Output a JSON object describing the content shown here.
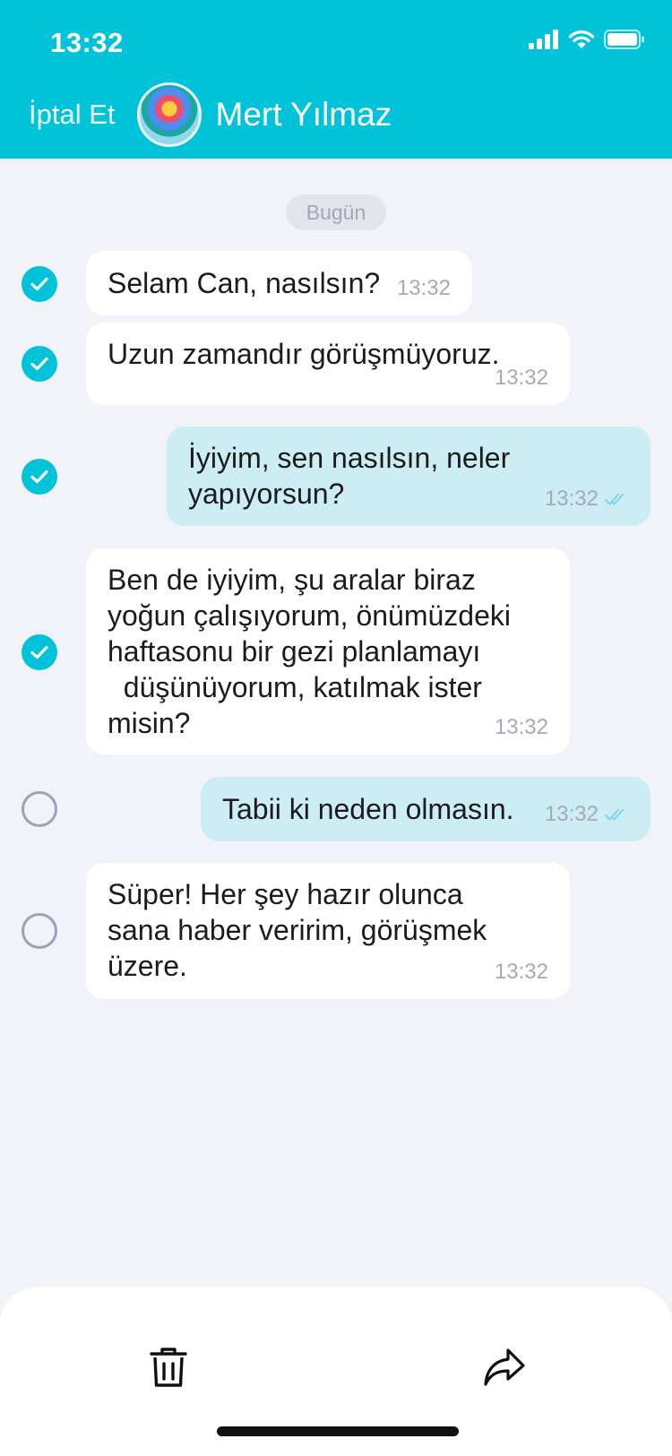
{
  "status_bar": {
    "time": "13:32"
  },
  "header": {
    "cancel_label": "İptal Et",
    "contact_name": "Mert Yılmaz"
  },
  "date_label": "Bugün",
  "messages": [
    {
      "text": "Selam Can, nasılsın?",
      "time": "13:32",
      "direction": "incoming",
      "selected": true
    },
    {
      "text": "Uzun zamandır görüşmüyoruz.",
      "time": "13:32",
      "direction": "incoming",
      "selected": true
    },
    {
      "text": "İyiyim, sen nasılsın, neler\nyapıyorsun?",
      "time": "13:32",
      "direction": "outgoing",
      "read": true,
      "selected": true
    },
    {
      "text": "Ben de iyiyim, şu aralar biraz\nyoğun çalışıyorum, önümüzdeki\nhaftasonu bir gezi planlamayı\n  düşünüyorum, katılmak ister\nmisin?",
      "time": "13:32",
      "direction": "incoming",
      "selected": true
    },
    {
      "text": "Tabii ki neden olmasın.",
      "time": "13:32",
      "direction": "outgoing",
      "read": true,
      "selected": false
    },
    {
      "text": "Süper! Her şey hazır olunca\nsana haber veririm, görüşmek\nüzere.",
      "time": "13:32",
      "direction": "incoming",
      "selected": false
    }
  ],
  "toolbar": {
    "delete_icon": "trash-icon",
    "forward_icon": "forward-arrow-icon"
  },
  "colors": {
    "accent": "#00c3d9",
    "background": "#f2f3f8",
    "incoming_bubble": "#ffffff",
    "outgoing_bubble": "#cdedf5"
  }
}
